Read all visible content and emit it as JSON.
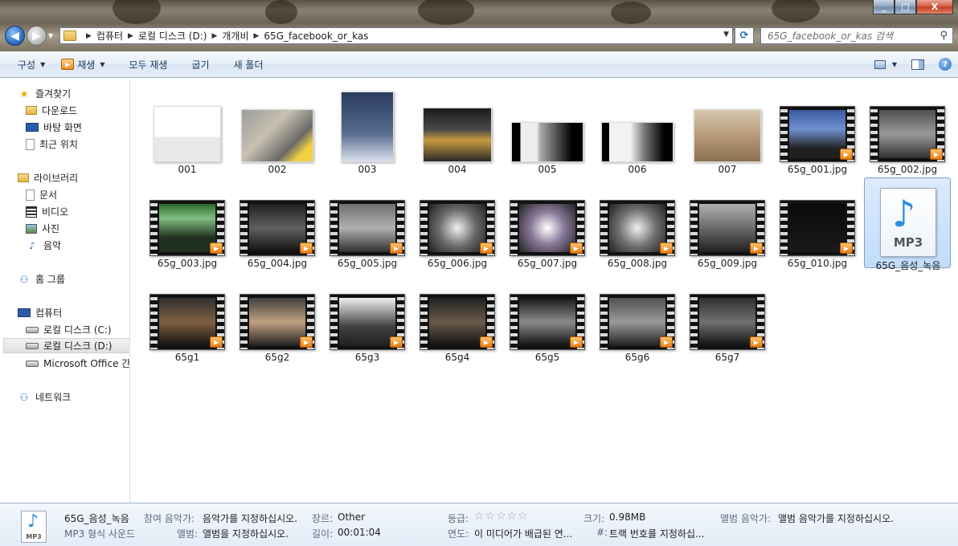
{
  "window": {
    "min": "_",
    "max": "□",
    "close": "X"
  },
  "address": {
    "crumbs": [
      "컴퓨터",
      "로컬 디스크 (D:)",
      "개개비",
      "65G_facebook_or_kas"
    ]
  },
  "search": {
    "placeholder": "65G_facebook_or_kas 검색"
  },
  "toolbar": {
    "organize": "구성",
    "play": "재생",
    "play_all": "모두 재생",
    "burn": "굽기",
    "new_folder": "새 폴더"
  },
  "sidebar": {
    "favorites": {
      "label": "즐겨찾기",
      "items": [
        "다운로드",
        "바탕 화면",
        "최근 위치"
      ]
    },
    "libraries": {
      "label": "라이브러리",
      "items": [
        "문서",
        "비디오",
        "사진",
        "음악"
      ]
    },
    "homegroup": "홈 그룹",
    "computer": {
      "label": "컴퓨터",
      "items": [
        "로컬 디스크 (C:)",
        "로컬 디스크 (D:)",
        "Microsoft Office 간편"
      ]
    },
    "network": "네트워크"
  },
  "files": [
    {
      "name": "001",
      "type": "photo"
    },
    {
      "name": "002",
      "type": "photo"
    },
    {
      "name": "003",
      "type": "photo"
    },
    {
      "name": "004",
      "type": "photo"
    },
    {
      "name": "005",
      "type": "photo"
    },
    {
      "name": "006",
      "type": "photo"
    },
    {
      "name": "007",
      "type": "photo"
    },
    {
      "name": "65g_001.jpg",
      "type": "video"
    },
    {
      "name": "65g_002.jpg",
      "type": "video"
    },
    {
      "name": "65g_003.jpg",
      "type": "video"
    },
    {
      "name": "65g_004.jpg",
      "type": "video"
    },
    {
      "name": "65g_005.jpg",
      "type": "video"
    },
    {
      "name": "65g_006.jpg",
      "type": "video"
    },
    {
      "name": "65g_007.jpg",
      "type": "video"
    },
    {
      "name": "65g_008.jpg",
      "type": "video"
    },
    {
      "name": "65g_009.jpg",
      "type": "video"
    },
    {
      "name": "65g_010.jpg",
      "type": "video"
    },
    {
      "name": "65G_음성_녹음",
      "type": "mp3",
      "icon_text": "MP3",
      "selected": true
    },
    {
      "name": "65g1",
      "type": "video"
    },
    {
      "name": "65g2",
      "type": "video"
    },
    {
      "name": "65g3",
      "type": "video"
    },
    {
      "name": "65g4",
      "type": "video"
    },
    {
      "name": "65g5",
      "type": "video"
    },
    {
      "name": "65g6",
      "type": "video"
    },
    {
      "name": "65g7",
      "type": "video"
    }
  ],
  "details": {
    "icon_text": "MP3",
    "name": "65G_음성_녹음",
    "type": "MP3 형식 사운드",
    "artist_key": "참여 음악가:",
    "artist_val": "음악가를 지정하십시오.",
    "album_key": "앨범:",
    "album_val": "앨범을 지정하십시오.",
    "genre_key": "장르:",
    "genre_val": "Other",
    "length_key": "길이:",
    "length_val": "00:01:04",
    "rating_key": "등급:",
    "rating_stars": "☆☆☆☆☆",
    "year_key": "연도:",
    "year_val": "이 미디어가 배급된 연...",
    "size_key": "크기:",
    "size_val": "0.98MB",
    "track_key": "#:",
    "track_val": "트랙 번호를 지정하십...",
    "album_artist_key": "앨범 음악가:",
    "album_artist_val": "앨범 음악가를 지정하십시오."
  }
}
